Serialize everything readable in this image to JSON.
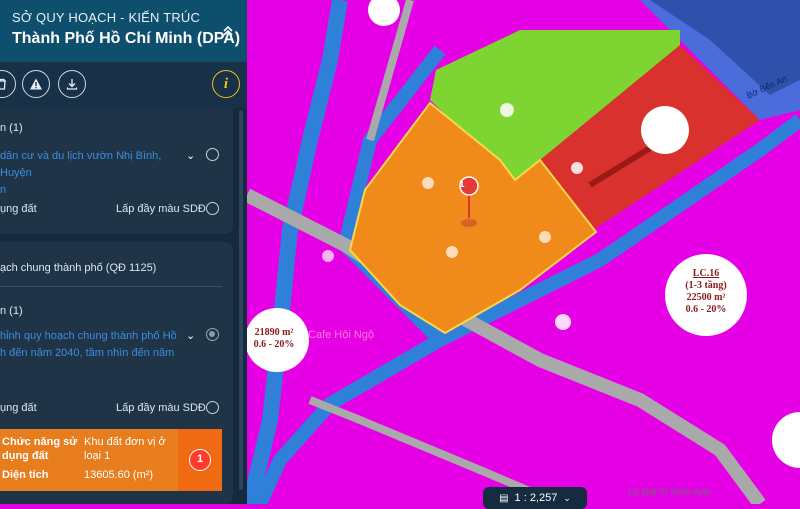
{
  "header": {
    "org": "SỞ QUY HOẠCH - KIẾN TRÚC",
    "city": "Thành Phố Hồ Chí Minh (DPA)",
    "collapse_icon": "chevron-up-double-icon"
  },
  "toolbar": {
    "icons": [
      "trash-icon",
      "warning-icon",
      "download-icon",
      "info-icon"
    ],
    "info_glyph": "i"
  },
  "card1": {
    "heading": "n (1)",
    "item": "dân cư và du lịch vườn Nhị Bình, Huyện",
    "item_cont": "n",
    "land_use_label": "ụng đất",
    "fill_label": "Lấp đầy màu SDĐ"
  },
  "card2": {
    "section": "ạch chung thành phố (QĐ 1125)",
    "heading": "n (1)",
    "item_l1": "hỉnh quy hoạch chung thành phố Hồ",
    "item_l2": "h đến năm 2040, tầm nhìn đến năm",
    "land_use_label": "ụng đất",
    "fill_label": "Lấp đầy màu SDĐ"
  },
  "result": {
    "func_label_1": "Chức năng sử",
    "func_label_2": "dụng đất",
    "func_value_1": "Khu đất đơn vị ở",
    "func_value_2": "loại 1",
    "area_label": "Diện tích",
    "area_value": "13605.60 (m²)",
    "badge": "1"
  },
  "map": {
    "marker_number": "1",
    "scale": "1 : 2,257",
    "poi_cafe": "Cafe Hội Ngộ",
    "plot_lc16": {
      "code": "LC.16",
      "floors": "(1-3 tầng)",
      "area": "22500 m²",
      "ratio": "0.6 - 20%"
    },
    "plot_left": {
      "area": "21890 m²",
      "ratio": "0.6 - 20%"
    },
    "road_ben_an": "Bờ Bến An",
    "road_lo_bai": "Lô Bài Tr Kinh Anh",
    "colors": {
      "residential": "#e600e6",
      "orange_plot": "#f08a1a",
      "green": "#7ed430",
      "red": "#d9322e",
      "canal": "#2f80d8",
      "road": "#a9a9a9"
    }
  }
}
